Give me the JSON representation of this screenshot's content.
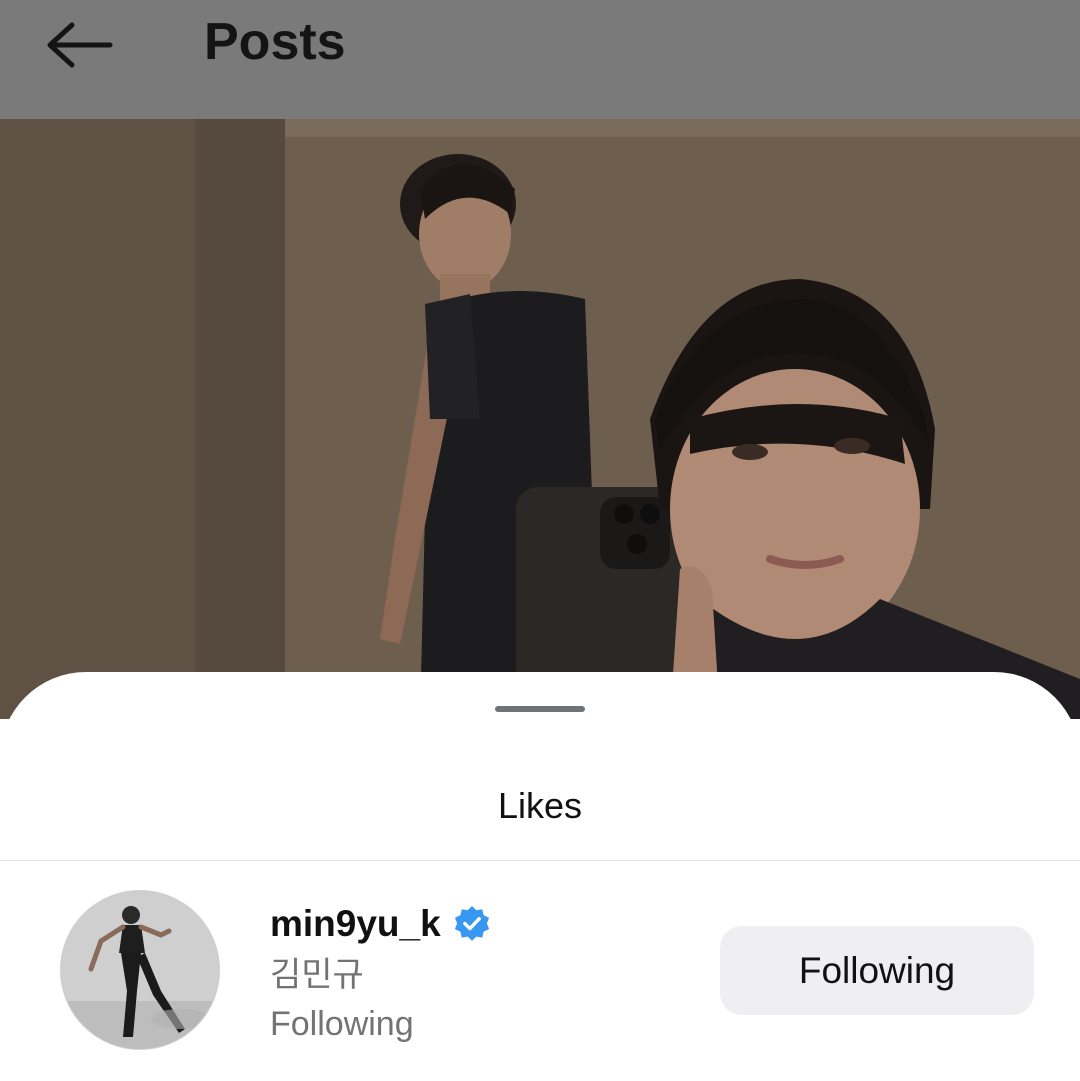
{
  "header": {
    "title": "Posts",
    "back_icon": "arrow-left-icon"
  },
  "sheet": {
    "title": "Likes"
  },
  "likes": [
    {
      "username": "min9yu_k",
      "verified": true,
      "full_name": "김민규",
      "status": "Following",
      "button_label": "Following"
    }
  ],
  "colors": {
    "header_overlay": "#7a7a7a",
    "verified_blue": "#3897f0",
    "secondary_text": "#737373",
    "button_bg": "#efeff2"
  }
}
